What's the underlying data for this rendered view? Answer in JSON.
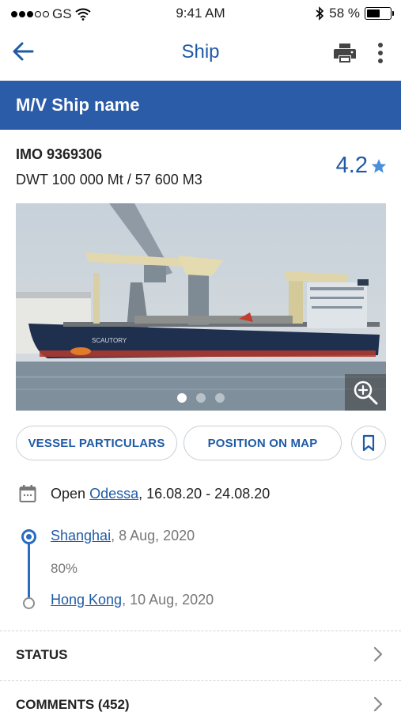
{
  "status_bar": {
    "carrier": "GS",
    "time": "9:41 AM",
    "battery_percent": "58 %",
    "battery_level": 0.58
  },
  "header": {
    "title": "Ship",
    "back_icon": "arrow-left-icon",
    "print_icon": "printer-icon",
    "more_icon": "more-vertical-icon"
  },
  "ship": {
    "name": "M/V Ship name",
    "imo": "IMO 9369306",
    "dwt": "DWT 100 000 Mt / 57 600 M3",
    "rating": "4.2",
    "hull_name": "SCAUTORY"
  },
  "carousel": {
    "count": 3,
    "active_index": 0
  },
  "actions": {
    "vessel_particulars": "VESSEL PARTICULARS",
    "position_on_map": "POSITION ON MAP"
  },
  "open": {
    "prefix": "Open",
    "port": "Odessa",
    "dates": ", 16.08.20 - 24.08.20"
  },
  "route": {
    "from_port": "Shanghai",
    "from_date": ", 8 Aug, 2020",
    "progress": "80%",
    "to_port": "Hong Kong",
    "to_date": ", 10 Aug, 2020"
  },
  "sections": [
    {
      "label": "STATUS"
    },
    {
      "label": "COMMENTS (452)"
    }
  ],
  "colors": {
    "accent": "#1f5aa6",
    "banner": "#2b5ca8",
    "star": "#4a90d9"
  }
}
